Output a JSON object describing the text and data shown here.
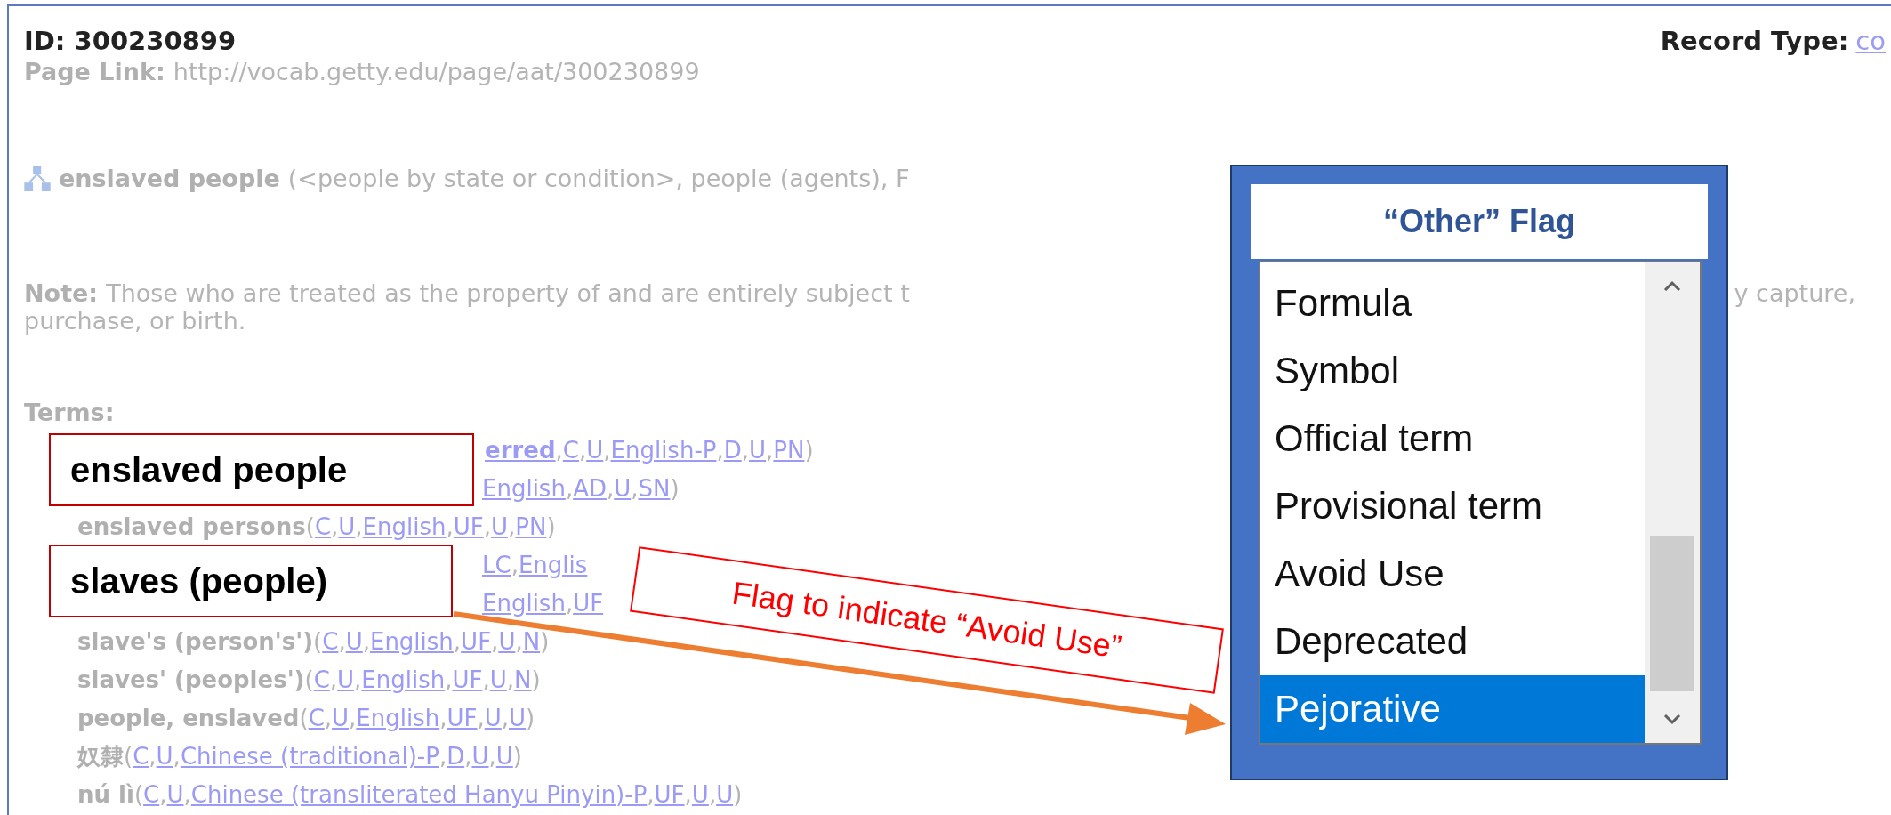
{
  "record": {
    "id_label": "ID:",
    "id": "300230899",
    "record_type_label": "Record Type:",
    "record_type": "co",
    "page_link_label": "Page Link:",
    "page_link": "http://vocab.getty.edu/page/aat/300230899"
  },
  "hierarchy": {
    "term": "enslaved people",
    "context": "(<people by state or condition>, people (agents), F"
  },
  "note": {
    "label": "Note:",
    "text_start": "Those who are treated as the property of and are entirely subject t",
    "text_end": "y capture,",
    "text_line2": "purchase, or birth."
  },
  "terms": {
    "label": "Terms:",
    "separator": ",",
    "rows": [
      {
        "fragment": "erred",
        "qualifiers": [
          "C",
          "U",
          "English-P",
          "D",
          "U",
          "PN"
        ],
        "close": ")"
      },
      {
        "qualifiers": [
          "English",
          "AD",
          "U",
          "SN"
        ],
        "close": ")"
      },
      {
        "term": "enslaved persons",
        "open": "(",
        "qualifiers": [
          "C",
          "U",
          "English",
          "UF",
          "U",
          "PN"
        ],
        "close": ")"
      },
      {
        "qualifiers": [
          "LC",
          "Englis"
        ]
      },
      {
        "qualifiers": [
          "English",
          "UF"
        ]
      },
      {
        "term": "slave's (person's')",
        "open": "(",
        "qualifiers": [
          "C",
          "U",
          "English",
          "UF",
          "U",
          "N"
        ],
        "close": ")"
      },
      {
        "term": "slaves' (peoples')",
        "open": "(",
        "qualifiers": [
          "C",
          "U",
          "English",
          "UF",
          "U",
          "N"
        ],
        "close": ")"
      },
      {
        "term": "people, enslaved",
        "open": "(",
        "qualifiers": [
          "C",
          "U",
          "English",
          "UF",
          "U",
          "U"
        ],
        "close": ")"
      },
      {
        "term": "奴隸",
        "open": "(",
        "qualifiers": [
          "C",
          "U",
          "Chinese (traditional)-P",
          "D",
          "U",
          "U"
        ],
        "close": ")"
      },
      {
        "term": "nú lì",
        "open": "(",
        "qualifiers": [
          "C",
          "U",
          "Chinese (transliterated Hanyu Pinyin)-P",
          "UF",
          "U",
          "U"
        ],
        "close": ")"
      }
    ]
  },
  "callouts": [
    {
      "kind": "term",
      "text": "enslaved people"
    },
    {
      "kind": "term",
      "text": "slaves (people)"
    },
    {
      "kind": "arrow-label",
      "text": "Flag to indicate “Avoid Use”"
    }
  ],
  "flag_panel": {
    "title": "“Other” Flag",
    "options": [
      {
        "label": "Formula",
        "selected": false
      },
      {
        "label": "Symbol",
        "selected": false
      },
      {
        "label": "Official term",
        "selected": false
      },
      {
        "label": "Provisional term",
        "selected": false
      },
      {
        "label": "Avoid Use",
        "selected": false
      },
      {
        "label": "Deprecated",
        "selected": false
      },
      {
        "label": "Pejorative",
        "selected": true
      }
    ]
  }
}
